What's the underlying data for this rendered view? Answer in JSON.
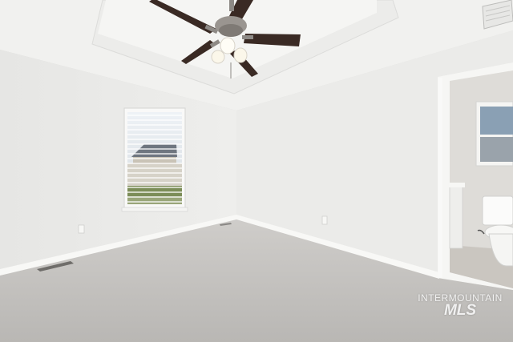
{
  "photo": {
    "subject": "empty bedroom",
    "watermark": {
      "line1": "INTERMOUNTAIN",
      "line2": "MLS"
    }
  },
  "colors": {
    "wall": "#ecebe9",
    "ceiling": "#f2f2f0",
    "carpet": "#c8c6c3",
    "baseboard": "#f7f7f5",
    "fan_blade": "#3a2a24"
  }
}
